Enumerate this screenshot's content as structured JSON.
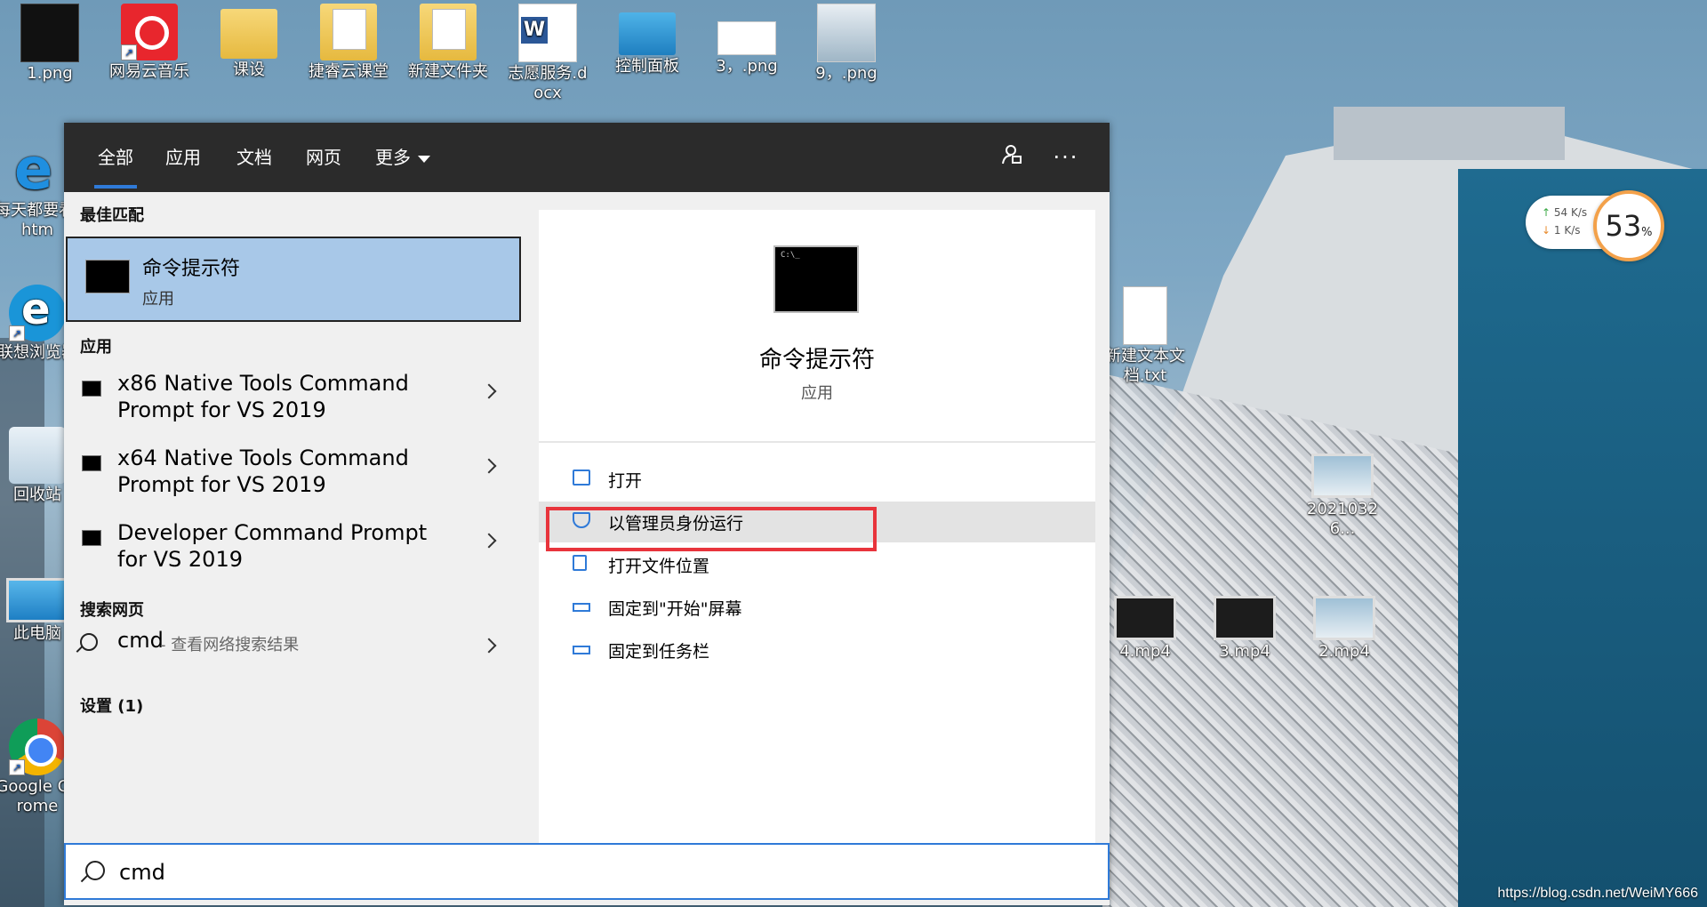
{
  "desktop": {
    "icons": [
      {
        "label": "1.png",
        "kind": "dark"
      },
      {
        "label": "网易云音乐",
        "kind": "red"
      },
      {
        "label": "课设",
        "kind": "folder"
      },
      {
        "label": "捷睿云课堂",
        "kind": "folder-doc"
      },
      {
        "label": "新建文件夹",
        "kind": "folder-doc"
      },
      {
        "label": "志愿服务.docx",
        "kind": "word"
      },
      {
        "label": "控制面板",
        "kind": "control-panel"
      },
      {
        "label": "3，.png",
        "kind": "png"
      },
      {
        "label": "9，.png",
        "kind": "png2"
      },
      {
        "label": "每天都要看.htm",
        "kind": "ie"
      },
      {
        "label": "联想浏览器",
        "kind": "edge"
      },
      {
        "label": "回收站",
        "kind": "recycle"
      },
      {
        "label": "此电脑",
        "kind": "pc"
      },
      {
        "label": "Google Chrome",
        "kind": "chrome"
      },
      {
        "label": "新建文本文档.txt",
        "kind": "txt"
      },
      {
        "label": "20210326...",
        "kind": "video-light"
      },
      {
        "label": "4.mp4",
        "kind": "video"
      },
      {
        "label": "3.mp4",
        "kind": "video"
      },
      {
        "label": "2.mp4",
        "kind": "video-light"
      }
    ]
  },
  "network_widget": {
    "up": "54  K/s",
    "down": "1   K/s",
    "percent": "53",
    "percent_unit": "%"
  },
  "search_panel": {
    "tabs": [
      "全部",
      "应用",
      "文档",
      "网页",
      "更多"
    ],
    "active_tab": "全部",
    "feedback_icon": "feedback-icon",
    "more_icon": "more-options-icon",
    "best_match": {
      "header": "最佳匹配",
      "title": "命令提示符",
      "subtitle": "应用"
    },
    "apps": {
      "header": "应用",
      "items": [
        "x86 Native Tools Command Prompt for VS 2019",
        "x64 Native Tools Command Prompt for VS 2019",
        "Developer Command Prompt for VS 2019"
      ]
    },
    "web": {
      "header": "搜索网页",
      "query": "cmd",
      "hint": " - 查看网络搜索结果"
    },
    "settings": {
      "header": "设置 (1)"
    },
    "preview": {
      "title": "命令提示符",
      "subtitle": "应用",
      "actions": [
        "打开",
        "以管理员身份运行",
        "打开文件位置",
        "固定到\"开始\"屏幕",
        "固定到任务栏"
      ],
      "highlighted_action": "以管理员身份运行"
    },
    "search_input": {
      "value": "cmd"
    }
  },
  "watermark": "https://blog.csdn.net/WeiMY666",
  "colors": {
    "accent": "#2f7ad8",
    "best_match_bg": "#a8c8e8",
    "topbar_bg": "#2b2b2b",
    "highlight_box": "#e8343c"
  }
}
